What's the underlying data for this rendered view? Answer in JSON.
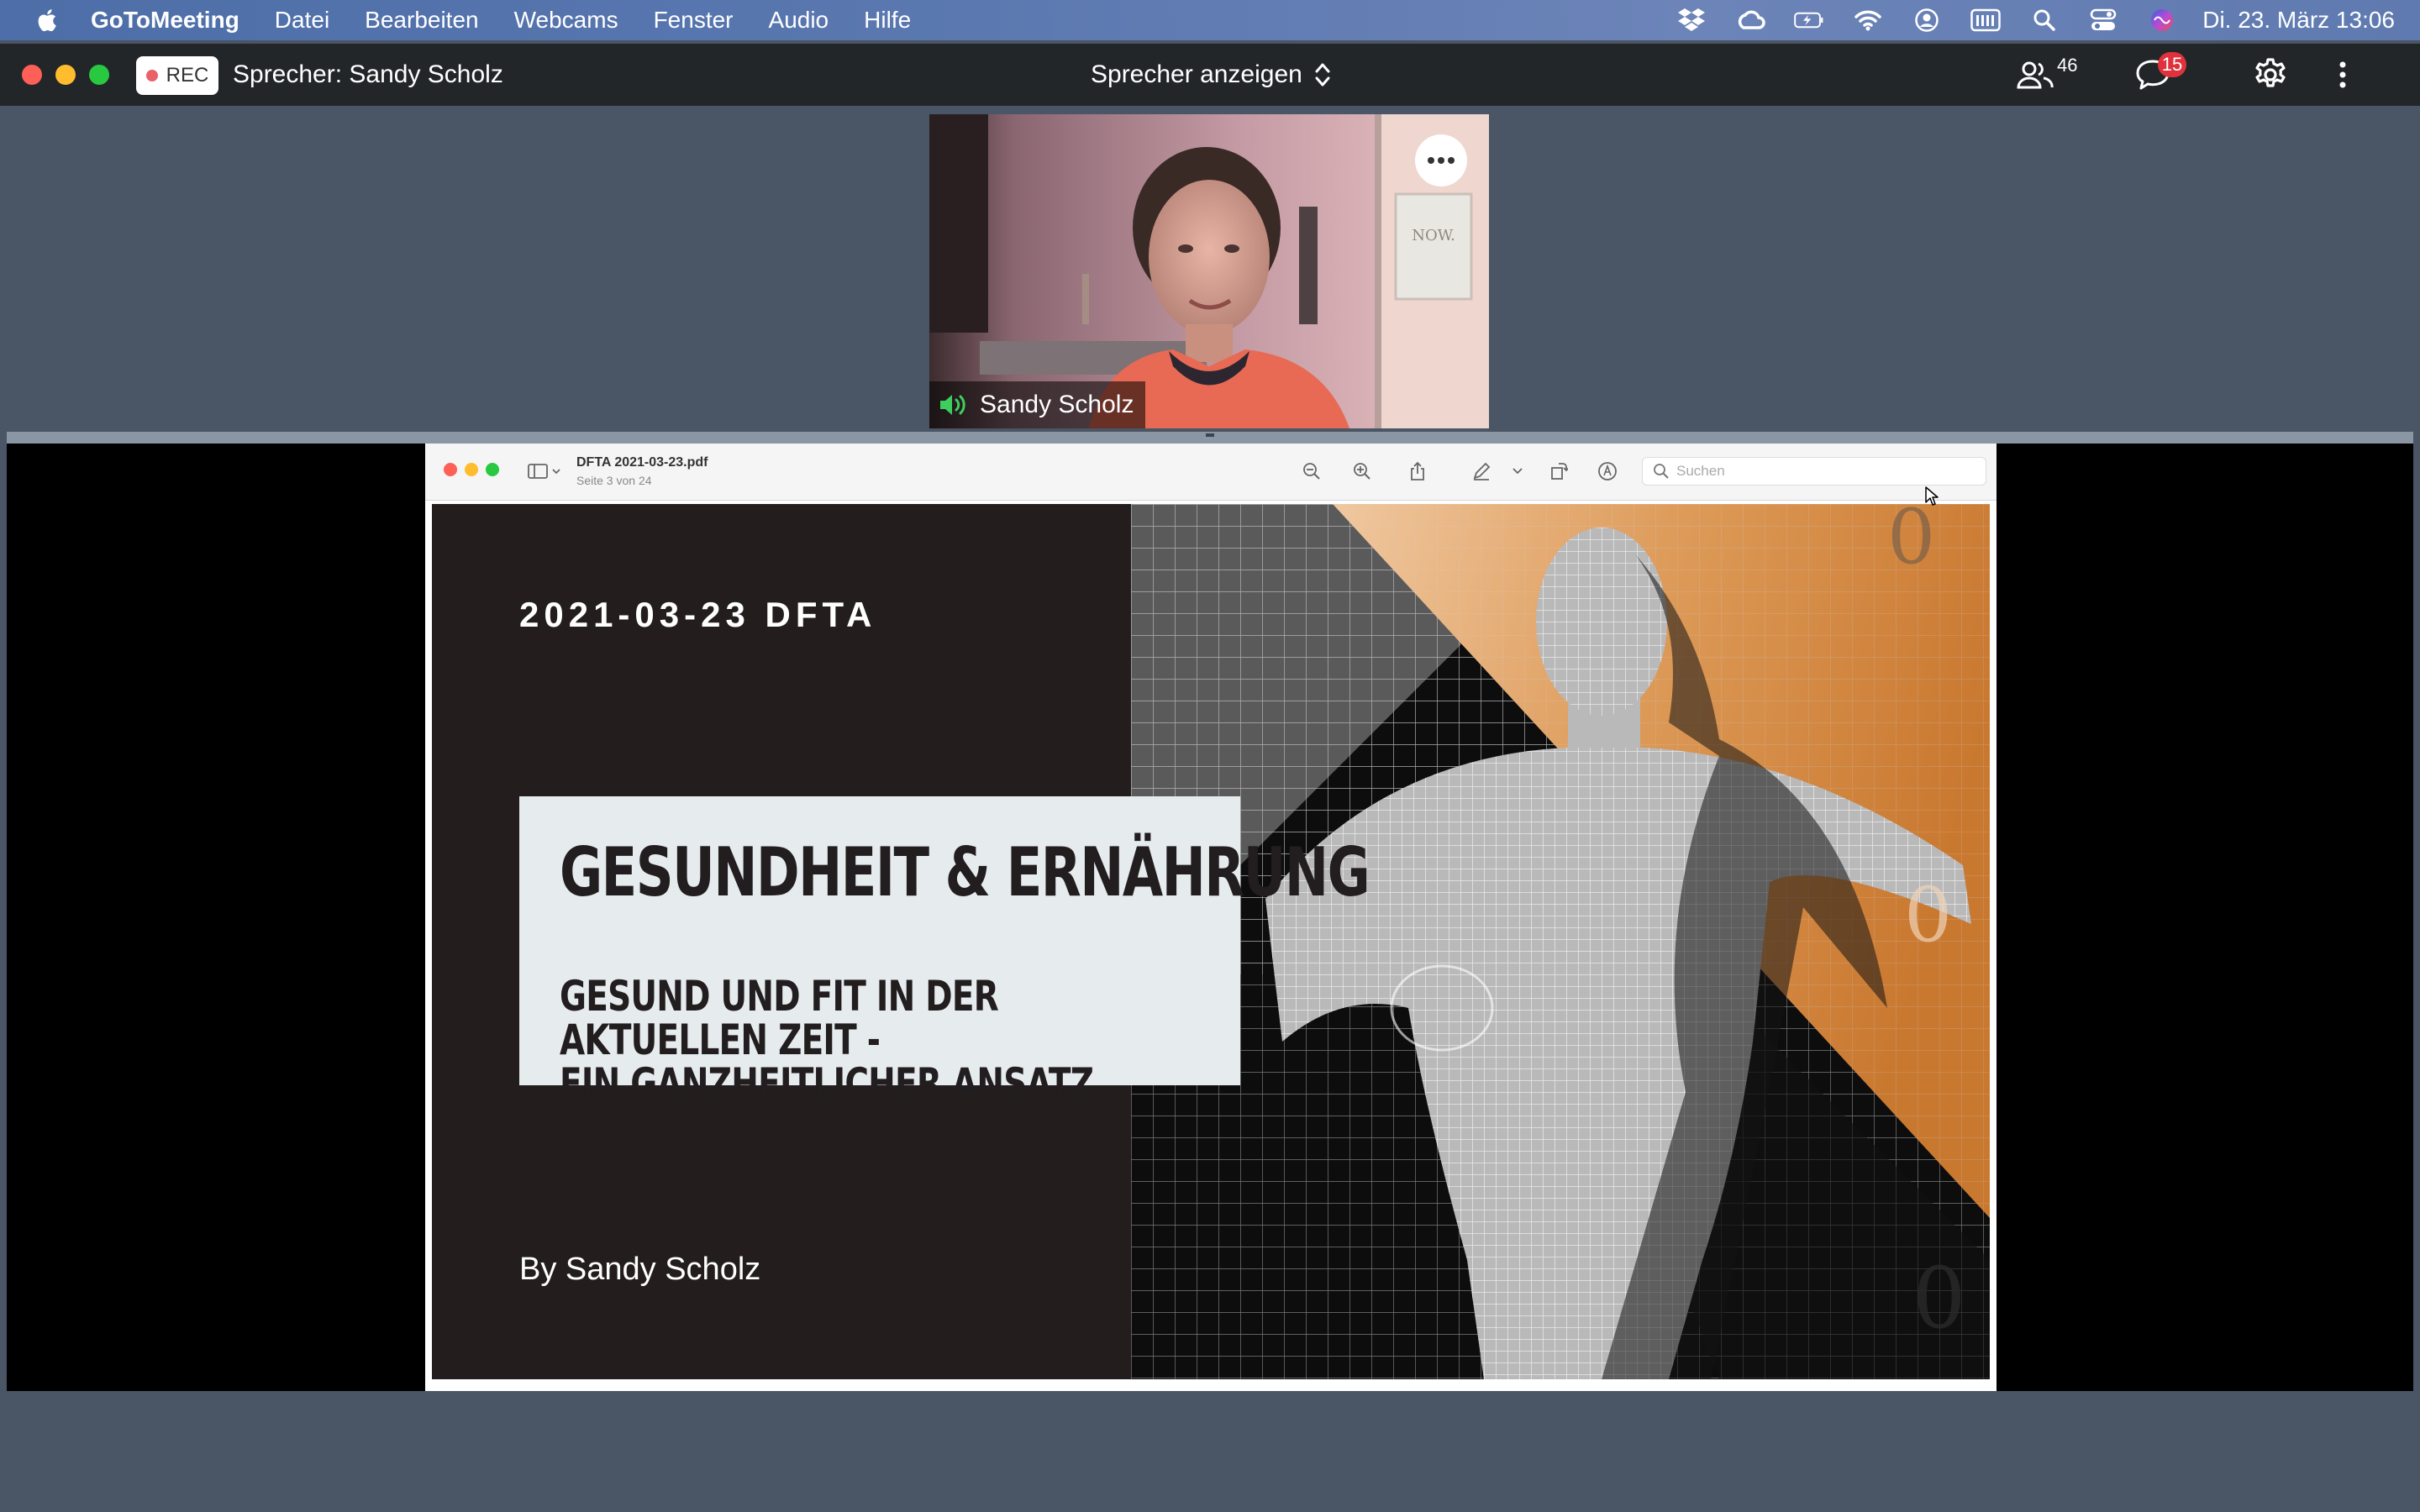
{
  "menubar": {
    "app_name": "GoToMeeting",
    "items": [
      "Datei",
      "Bearbeiten",
      "Webcams",
      "Fenster",
      "Audio",
      "Hilfe"
    ],
    "clock": "Di. 23. März  13:06",
    "status_icons": [
      "dropbox-icon",
      "creative-cloud-icon",
      "battery-charging-icon",
      "wifi-icon",
      "user-account-icon",
      "keyboard-input-icon",
      "spotlight-search-icon",
      "control-center-icon",
      "siri-icon"
    ]
  },
  "titlebar": {
    "rec_label": "REC",
    "speaker_label": "Sprecher: Sandy Scholz",
    "view_mode": "Sprecher anzeigen",
    "attendee_count": "46",
    "chat_count": "15"
  },
  "webcam": {
    "name": "Sandy Scholz"
  },
  "preview": {
    "file_name": "DFTA 2021-03-23.pdf",
    "page_info": "Seite 3 von 24",
    "search_placeholder": "Suchen"
  },
  "slide": {
    "date_line": "2021-03-23 DFTA",
    "title": "GESUNDHEIT & ERNÄHRUNG",
    "subtitle_line1": "GESUND UND FIT IN DER AKTUELLEN ZEIT -",
    "subtitle_line2": "EIN GANZHEITLICHER ANSATZ",
    "author": "By Sandy Scholz"
  },
  "colors": {
    "title_bar": "#232629",
    "rec_dot": "#e9626a",
    "chat_badge": "#e0323c",
    "slide_dark": "#231d1e",
    "slide_light_box": "#e6ebee",
    "slide_orange": "#d88d45",
    "speaking_green": "#3ccf5e"
  }
}
